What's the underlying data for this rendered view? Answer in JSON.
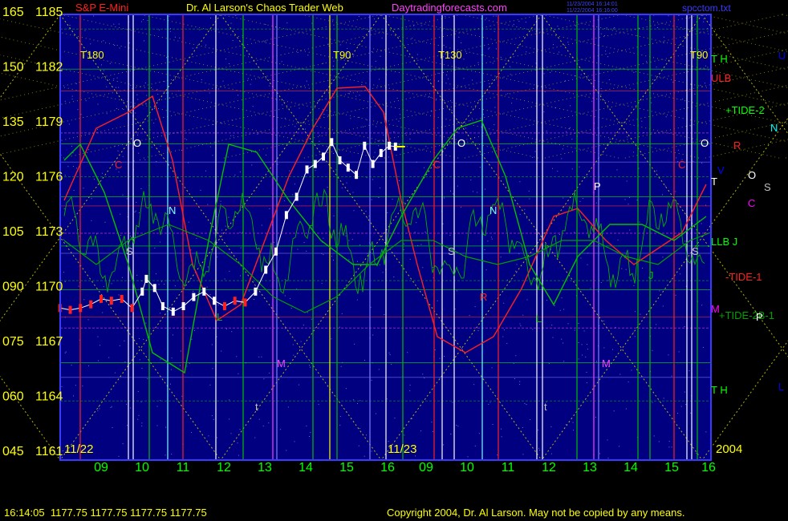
{
  "header": {
    "instrument": "S&P E-Mini",
    "site_title": "Dr. Al Larson's Chaos Trader Web",
    "site_url": "Daytradingforecasts.com",
    "stamp_1": "11/23/2004 16:14:01",
    "stamp_2": "11/22/2004 16:16:00",
    "file_name": "spcctom.txt"
  },
  "footer": {
    "status_line": "16:14:05  1177.75 1177.75 1177.75 1177.75",
    "copyright": "Copyright 2004, Dr. Al Larson. May not be copied by any means."
  },
  "colors": {
    "background": "#000080",
    "axis_text": "#ffff00",
    "price_up": "#ffffff",
    "price_down": "#ff2020",
    "frame": "#3a3aff"
  },
  "chart_data": {
    "type": "line",
    "y_left_labels": [
      "165",
      "150",
      "135",
      "120",
      "105",
      "090",
      "075",
      "060",
      "045"
    ],
    "y_right_prices": [
      "1185",
      "1182",
      "1179",
      "1176",
      "1173",
      "1170",
      "1167",
      "1164",
      "1161"
    ],
    "ylim": [
      1161,
      1185
    ],
    "x_hour_labels": [
      "09",
      "10",
      "11",
      "12",
      "13",
      "14",
      "15",
      "16",
      "09",
      "10",
      "11",
      "12",
      "13",
      "14",
      "15",
      "16"
    ],
    "dates": [
      "11/22",
      "11/23"
    ],
    "year": "2004",
    "time_markers": [
      "T180",
      "T90",
      "T130",
      "T90"
    ],
    "right_labels": [
      {
        "text": "T  H",
        "color": "#00ff00"
      },
      {
        "text": "U",
        "color": "#0000ff"
      },
      {
        "text": "ULB",
        "color": "#ff2020"
      },
      {
        "text": "+TIDE-2",
        "color": "#00ff00"
      },
      {
        "text": "N",
        "color": "#00ffff"
      },
      {
        "text": "R",
        "color": "#ff2020"
      },
      {
        "text": "O",
        "color": "#ffffff"
      },
      {
        "text": "V",
        "color": "#0000ff"
      },
      {
        "text": "S",
        "color": "#c0c0c0"
      },
      {
        "text": "T",
        "color": "#ffffff"
      },
      {
        "text": "C",
        "color": "#ff00ff"
      },
      {
        "text": "LLB  J",
        "color": "#00ff00"
      },
      {
        "text": "-TIDE-1",
        "color": "#ff2020"
      },
      {
        "text": "M",
        "color": "#ff00ff"
      },
      {
        "text": "+TIDE-2B-1",
        "color": "#00a000"
      },
      {
        "text": "P",
        "color": "#ffffff"
      },
      {
        "text": "T  H",
        "color": "#00ff00"
      },
      {
        "text": "L",
        "color": "#0000ff"
      }
    ],
    "planet_marks": [
      "O",
      "C",
      "N",
      "S",
      "L",
      "M",
      "t",
      "O",
      "C",
      "S",
      "N",
      "t",
      "P",
      "M",
      "O",
      "C",
      "S",
      "R",
      "J",
      "L"
    ],
    "series": [
      {
        "name": "S&P E-Mini",
        "type": "price-bars",
        "x_hour": [
          8.0,
          8.25,
          8.5,
          8.75,
          9.0,
          9.25,
          9.5,
          9.75,
          10.0,
          10.1,
          10.3,
          10.5,
          10.75,
          11.0,
          11.25,
          11.5,
          11.75,
          12.0,
          12.25,
          12.5,
          12.75,
          13.0,
          13.25,
          13.5,
          13.75,
          14.0,
          14.2,
          14.4,
          14.6,
          14.8,
          15.0,
          15.2,
          15.4,
          15.6,
          15.8,
          16.0,
          16.15
        ],
        "price": [
          1168.9,
          1168.8,
          1168.9,
          1169.1,
          1169.4,
          1169.3,
          1169.4,
          1168.9,
          1169.8,
          1170.5,
          1170.0,
          1169.0,
          1168.7,
          1169.0,
          1169.5,
          1169.8,
          1169.3,
          1169.0,
          1169.3,
          1169.2,
          1169.8,
          1171.0,
          1172.0,
          1174.0,
          1175.0,
          1176.5,
          1176.8,
          1177.2,
          1178.0,
          1177.0,
          1176.6,
          1176.2,
          1177.8,
          1176.8,
          1177.4,
          1177.8,
          1177.75
        ]
      }
    ],
    "grid": true
  }
}
